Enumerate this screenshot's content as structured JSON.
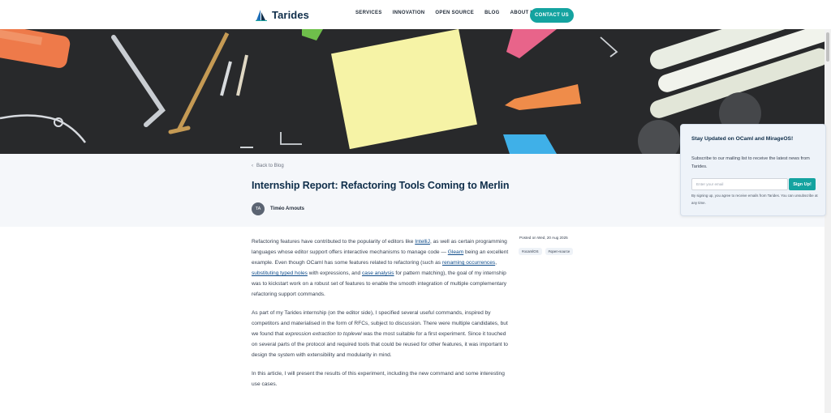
{
  "nav": {
    "brand": "Tarides",
    "links": [
      "SERVICES",
      "INNOVATION",
      "OPEN SOURCE",
      "BLOG",
      "ABOUT US"
    ],
    "cta": "CONTACT US"
  },
  "colors": {
    "accent": "#14a3a0",
    "brand_navy": "#0f2e4a",
    "link": "#0f4c8a"
  },
  "post": {
    "back": "Back to Blog",
    "title": "Internship Report: Refactoring Tools Coming to Merlin",
    "author_initials": "TA",
    "author": "Timéo Arnouts",
    "posted": "Posted on Wed, 20 Aug 2025",
    "tags": [
      "#ocamlOS",
      "#open-source"
    ],
    "p1": [
      "Refactoring features have contributed to the popularity of editors like ",
      "IntelliJ",
      ", as well as certain programming languages whose editor support offers interactive mechanisms to manage code — ",
      "Gleam",
      " being an excellent example. Even though OCaml has some features related to refactoring (such as ",
      "renaming occurrences",
      ", ",
      "substituting typed holes",
      " with expressions, and ",
      "case analysis",
      " for pattern matching), the goal of my internship was to kickstart work on a robust set of features to enable the smooth integration of multiple complementary refactoring support commands."
    ],
    "p2": [
      "As part of my Tarides internship (on the editor side), I specified several useful commands, inspired by competitors and materialised in the form of RFCs, subject to discussion. There were multiple candidates, but we found that ",
      "expression extraction to toplevel",
      " was the most suitable for a first experiment. Since it touched on several parts of the protocol and required tools that could be reused for other features, it was important to design the system with extensibility and modularity in mind."
    ],
    "p3": "In this article, I will present the results of this experiment, including the new command and some interesting use cases."
  },
  "newsletter": {
    "title": "Stay Updated on OCaml and MirageOS!",
    "desc": "Subscribe to our mailing list to receive the latest news from Tarides.",
    "placeholder": "Enter your email",
    "button": "Sign Up!",
    "fine": "By signing up, you agree to receive emails from Tarides. You can unsubscribe at any time."
  },
  "icons": {
    "back": "chevron-left-icon",
    "logo": "sail-logo-icon"
  }
}
